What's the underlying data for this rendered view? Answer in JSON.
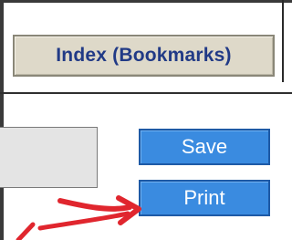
{
  "toolbar": {
    "index_label": "Index (Bookmarks)",
    "save_label": "Save",
    "print_label": "Print"
  },
  "colors": {
    "index_button_bg": "#ded9c9",
    "index_text": "#213a86",
    "action_button_bg": "#3a8be0",
    "annotation_arrow": "#e0262e"
  },
  "icons": {
    "annotation": "red-arrow-icon"
  }
}
